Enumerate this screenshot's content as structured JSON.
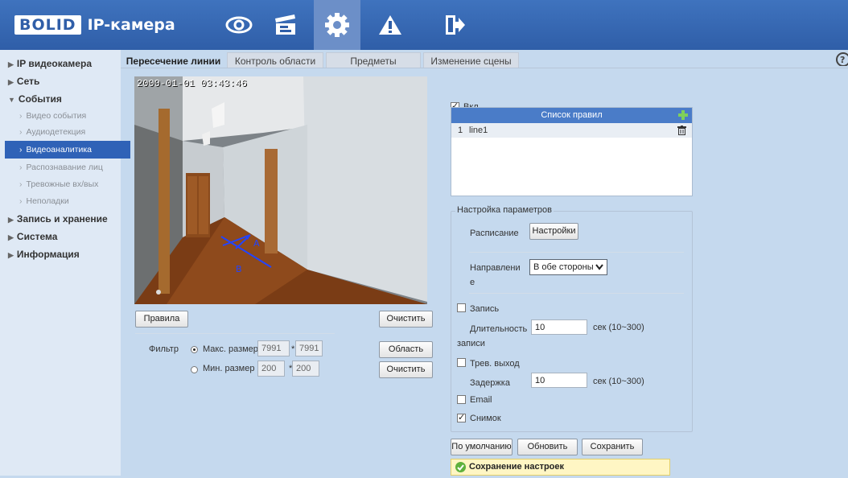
{
  "header": {
    "logo_brand": "BOLID",
    "logo_product": "IP-камера",
    "nav": [
      {
        "name": "live-view",
        "icon": "eye-icon"
      },
      {
        "name": "playback",
        "icon": "clapperboard-icon"
      },
      {
        "name": "settings",
        "icon": "gear-icon"
      },
      {
        "name": "alarm",
        "icon": "warning-icon"
      },
      {
        "name": "logout",
        "icon": "exit-icon"
      }
    ]
  },
  "sidebar": {
    "ip_camera": "IP видеокамера",
    "network": "Сеть",
    "events": "События",
    "events_sub": [
      "Видео события",
      "Аудиодетекция",
      "Видеоаналитика",
      "Распознавание лиц",
      "Тревожные вх/вых",
      "Неполадки"
    ],
    "recording": "Запись и хранение",
    "system": "Система",
    "info": "Информация"
  },
  "tabs": [
    "Пересечение линии",
    "Контроль области",
    "Предметы",
    "Изменение сцены"
  ],
  "video": {
    "timestamp": "2000-01-01 03:43:46",
    "line_a": "A",
    "line_b": "B"
  },
  "controls": {
    "rules_btn": "Правила",
    "clear_btn": "Очистить",
    "area_btn": "Область",
    "clear_btn2": "Очистить",
    "filter_label": "Фильтр",
    "max_size_label": "Макс. размер",
    "max_w": "7991",
    "max_h": "7991",
    "min_size_label": "Мин. размер",
    "min_w": "200",
    "min_h": "200",
    "times": "*"
  },
  "right": {
    "enable_label": "Вкл.",
    "rules_title": "Список правил",
    "rule_index": "1",
    "rule_name": "line1",
    "params_legend": "Настройка параметров",
    "schedule_label": "Расписание",
    "schedule_btn": "Настройки",
    "direction_label_1": "Направлени",
    "direction_label_2": "е",
    "direction_value": "В обе стороны",
    "record_label": "Запись",
    "rec_duration_label_1": "Длительность",
    "rec_duration_label_2": "записи",
    "rec_duration_value": "10",
    "rec_duration_unit": "сек (10~300)",
    "alarm_out_label": "Трев. выход",
    "delay_label": "Задержка",
    "delay_value": "10",
    "delay_unit": "сек (10~300)",
    "email_label": "Email",
    "snapshot_label": "Снимок",
    "default_btn": "По умолчанию",
    "refresh_btn": "Обновить",
    "save_btn": "Сохранить",
    "notice": "Сохранение настроек"
  }
}
